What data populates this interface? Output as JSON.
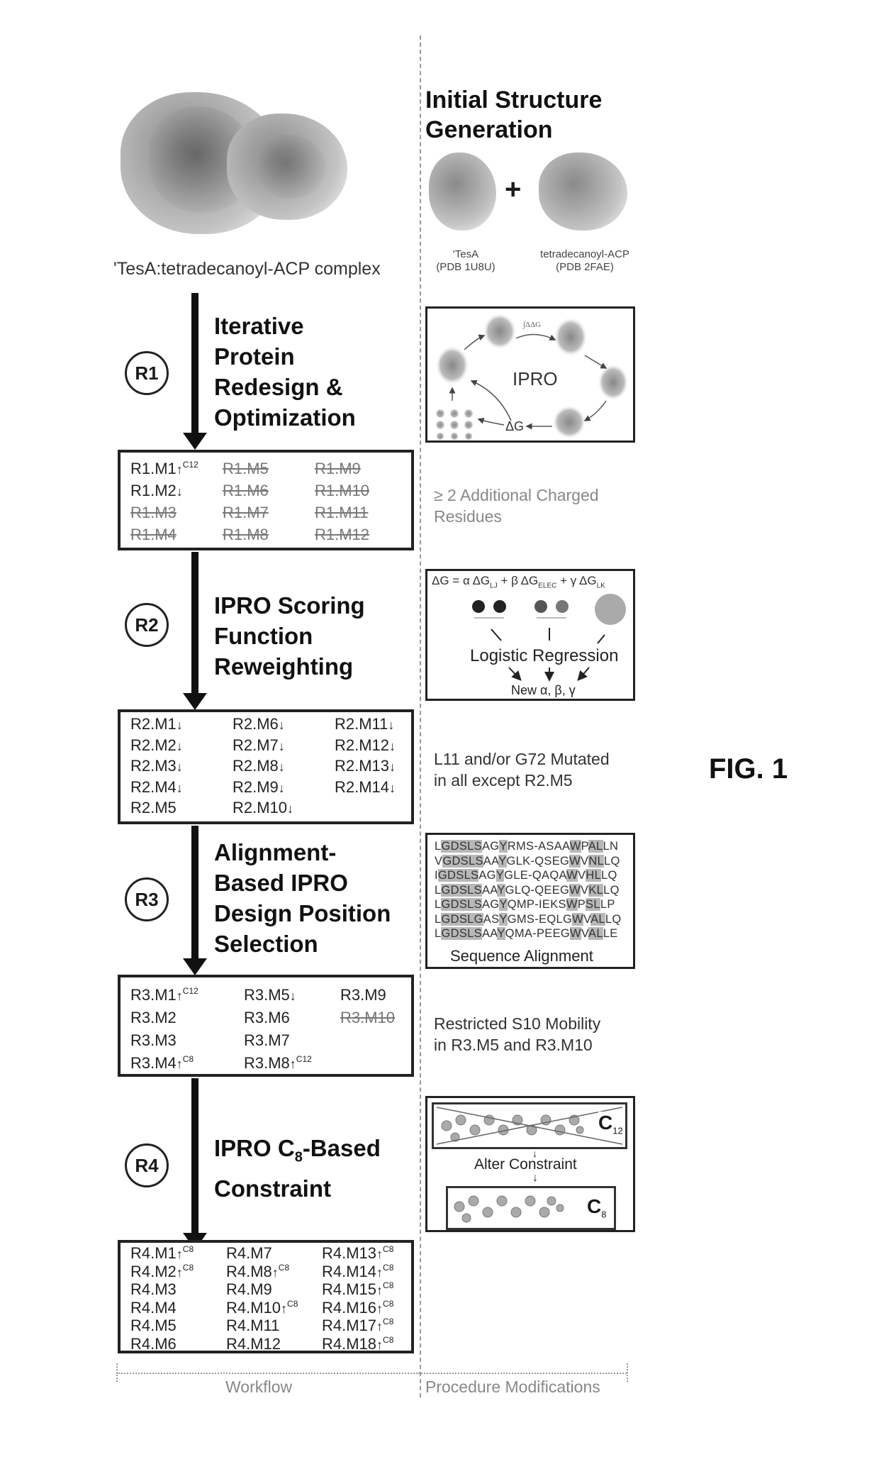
{
  "figure_label": "FIG. 1",
  "top": {
    "complex_caption": "'TesA:tetradecanoyl-ACP complex",
    "init_heading_line1": "Initial Structure",
    "init_heading_line2": "Generation",
    "plus": "+",
    "tesa_name": "'TesA",
    "tesa_pdb": "(PDB 1U8U)",
    "acp_name": "tetradecanoyl-ACP",
    "acp_pdb": "(PDB 2FAE)"
  },
  "rounds": [
    {
      "badge": "R1",
      "title_lines": [
        "Iterative",
        "Protein",
        "Redesign &",
        "Optimization"
      ],
      "note_lines": [
        "≥ 2 Additional Charged",
        "Residues"
      ],
      "mutants": [
        {
          "label": "R1.M1",
          "arrow": "↑",
          "sup": "C12",
          "struck": false
        },
        {
          "label": "R1.M2",
          "arrow": "↓",
          "sup": "",
          "struck": false
        },
        {
          "label": "R1.M3",
          "arrow": "",
          "sup": "",
          "struck": true
        },
        {
          "label": "R1.M4",
          "arrow": "",
          "sup": "",
          "struck": true
        },
        {
          "label": "R1.M5",
          "arrow": "",
          "sup": "",
          "struck": true
        },
        {
          "label": "R1.M6",
          "arrow": "",
          "sup": "",
          "struck": true
        },
        {
          "label": "R1.M7",
          "arrow": "",
          "sup": "",
          "struck": true
        },
        {
          "label": "R1.M8",
          "arrow": "",
          "sup": "",
          "struck": true
        },
        {
          "label": "R1.M9",
          "arrow": "",
          "sup": "",
          "struck": true
        },
        {
          "label": "R1.M10",
          "arrow": "",
          "sup": "",
          "struck": true
        },
        {
          "label": "R1.M11",
          "arrow": "",
          "sup": "",
          "struck": true
        },
        {
          "label": "R1.M12",
          "arrow": "",
          "sup": "",
          "struck": true
        }
      ]
    },
    {
      "badge": "R2",
      "title_lines": [
        "IPRO Scoring",
        "Function",
        "Reweighting"
      ],
      "note_lines": [
        "L11 and/or G72 Mutated",
        "in all except R2.M5"
      ],
      "mutants": [
        {
          "label": "R2.M1",
          "arrow": "↓",
          "sup": "",
          "struck": false
        },
        {
          "label": "R2.M2",
          "arrow": "↓",
          "sup": "",
          "struck": false
        },
        {
          "label": "R2.M3",
          "arrow": "↓",
          "sup": "",
          "struck": false
        },
        {
          "label": "R2.M4",
          "arrow": "↓",
          "sup": "",
          "struck": false
        },
        {
          "label": "R2.M5",
          "arrow": "",
          "sup": "",
          "struck": false
        },
        {
          "label": "R2.M6",
          "arrow": "↓",
          "sup": "",
          "struck": false
        },
        {
          "label": "R2.M7",
          "arrow": "↓",
          "sup": "",
          "struck": false
        },
        {
          "label": "R2.M8",
          "arrow": "↓",
          "sup": "",
          "struck": false
        },
        {
          "label": "R2.M9",
          "arrow": "↓",
          "sup": "",
          "struck": false
        },
        {
          "label": "R2.M10",
          "arrow": "↓",
          "sup": "",
          "struck": false
        },
        {
          "label": "R2.M11",
          "arrow": "↓",
          "sup": "",
          "struck": false
        },
        {
          "label": "R2.M12",
          "arrow": "↓",
          "sup": "",
          "struck": false
        },
        {
          "label": "R2.M13",
          "arrow": "↓",
          "sup": "",
          "struck": false
        },
        {
          "label": "R2.M14",
          "arrow": "↓",
          "sup": "",
          "struck": false
        }
      ]
    },
    {
      "badge": "R3",
      "title_lines": [
        "Alignment-",
        "Based IPRO",
        "Design Position",
        "Selection"
      ],
      "note_lines": [
        "Restricted S10 Mobility",
        "in R3.M5 and R3.M10"
      ],
      "mutants": [
        {
          "label": "R3.M1",
          "arrow": "↑",
          "sup": "C12",
          "struck": false
        },
        {
          "label": "R3.M2",
          "arrow": "",
          "sup": "",
          "struck": false
        },
        {
          "label": "R3.M3",
          "arrow": "",
          "sup": "",
          "struck": false
        },
        {
          "label": "R3.M4",
          "arrow": "↑",
          "sup": "C8",
          "struck": false
        },
        {
          "label": "R3.M5",
          "arrow": "↓",
          "sup": "",
          "struck": false
        },
        {
          "label": "R3.M6",
          "arrow": "",
          "sup": "",
          "struck": false
        },
        {
          "label": "R3.M7",
          "arrow": "",
          "sup": "",
          "struck": false
        },
        {
          "label": "R3.M8",
          "arrow": "↑",
          "sup": "C12",
          "struck": false
        },
        {
          "label": "R3.M9",
          "arrow": "",
          "sup": "",
          "struck": false
        },
        {
          "label": "R3.M10",
          "arrow": "",
          "sup": "",
          "struck": true
        }
      ]
    },
    {
      "badge": "R4",
      "title_line1_pre": "IPRO C",
      "title_line1_sub": "8",
      "title_line1_post": "-Based",
      "title_line2": "Constraint",
      "mutants": [
        {
          "label": "R4.M1",
          "arrow": "↑",
          "sup": "C8",
          "struck": false
        },
        {
          "label": "R4.M2",
          "arrow": "↑",
          "sup": "C8",
          "struck": false
        },
        {
          "label": "R4.M3",
          "arrow": "",
          "sup": "",
          "struck": false
        },
        {
          "label": "R4.M4",
          "arrow": "",
          "sup": "",
          "struck": false
        },
        {
          "label": "R4.M5",
          "arrow": "",
          "sup": "",
          "struck": false
        },
        {
          "label": "R4.M6",
          "arrow": "",
          "sup": "",
          "struck": false
        },
        {
          "label": "R4.M7",
          "arrow": "",
          "sup": "",
          "struck": false
        },
        {
          "label": "R4.M8",
          "arrow": "↑",
          "sup": "C8",
          "struck": false
        },
        {
          "label": "R4.M9",
          "arrow": "",
          "sup": "",
          "struck": false
        },
        {
          "label": "R4.M10",
          "arrow": "↑",
          "sup": "C8",
          "struck": false
        },
        {
          "label": "R4.M11",
          "arrow": "",
          "sup": "",
          "struck": false
        },
        {
          "label": "R4.M12",
          "arrow": "",
          "sup": "",
          "struck": false
        },
        {
          "label": "R4.M13",
          "arrow": "↑",
          "sup": "C8",
          "struck": false
        },
        {
          "label": "R4.M14",
          "arrow": "↑",
          "sup": "C8",
          "struck": false
        },
        {
          "label": "R4.M15",
          "arrow": "↑",
          "sup": "C8",
          "struck": false
        },
        {
          "label": "R4.M16",
          "arrow": "↑",
          "sup": "C8",
          "struck": false
        },
        {
          "label": "R4.M17",
          "arrow": "↑",
          "sup": "C8",
          "struck": false
        },
        {
          "label": "R4.M18",
          "arrow": "↑",
          "sup": "C8",
          "struck": false
        }
      ]
    }
  ],
  "panels": {
    "ipro_cycle": {
      "label": "IPRO",
      "delta_g": "ΔG",
      "top_note": "∫ΔΔG"
    },
    "scoring": {
      "equation": {
        "dg": "ΔG = α ΔG",
        "sub1": "LJ",
        "mid1": " + β ΔG",
        "sub2": "ELEC",
        "mid2": " + γ ΔG",
        "sub3": "LK"
      },
      "regression": "Logistic Regression",
      "output": "New α, β, γ"
    },
    "alignment": {
      "sequences": [
        "LGDSLSAGYRMS-ASAAWPALLN",
        "VGDSLSAAYGLK-QSEGWVNLLQ",
        "IGDSLSAGYGLE-QAQAWVHLLQ",
        "LGDSLSAAYGLQ-QEEGWVKLLQ",
        "LGDSLSAGYQMP-IEKSWPSLLP",
        "LGDSLGASYGMS-EQLGWVALLQ",
        "LGDSLSAAYQMA-PEEGWVALLE"
      ],
      "caption": "Sequence Alignment"
    },
    "constraint": {
      "c12_main": "C",
      "c12_sub": "12",
      "alter": "Alter Constraint",
      "c8_main": "C",
      "c8_sub": "8"
    }
  },
  "footer": {
    "workflow": "Workflow",
    "procedure": "Procedure Modifications"
  }
}
